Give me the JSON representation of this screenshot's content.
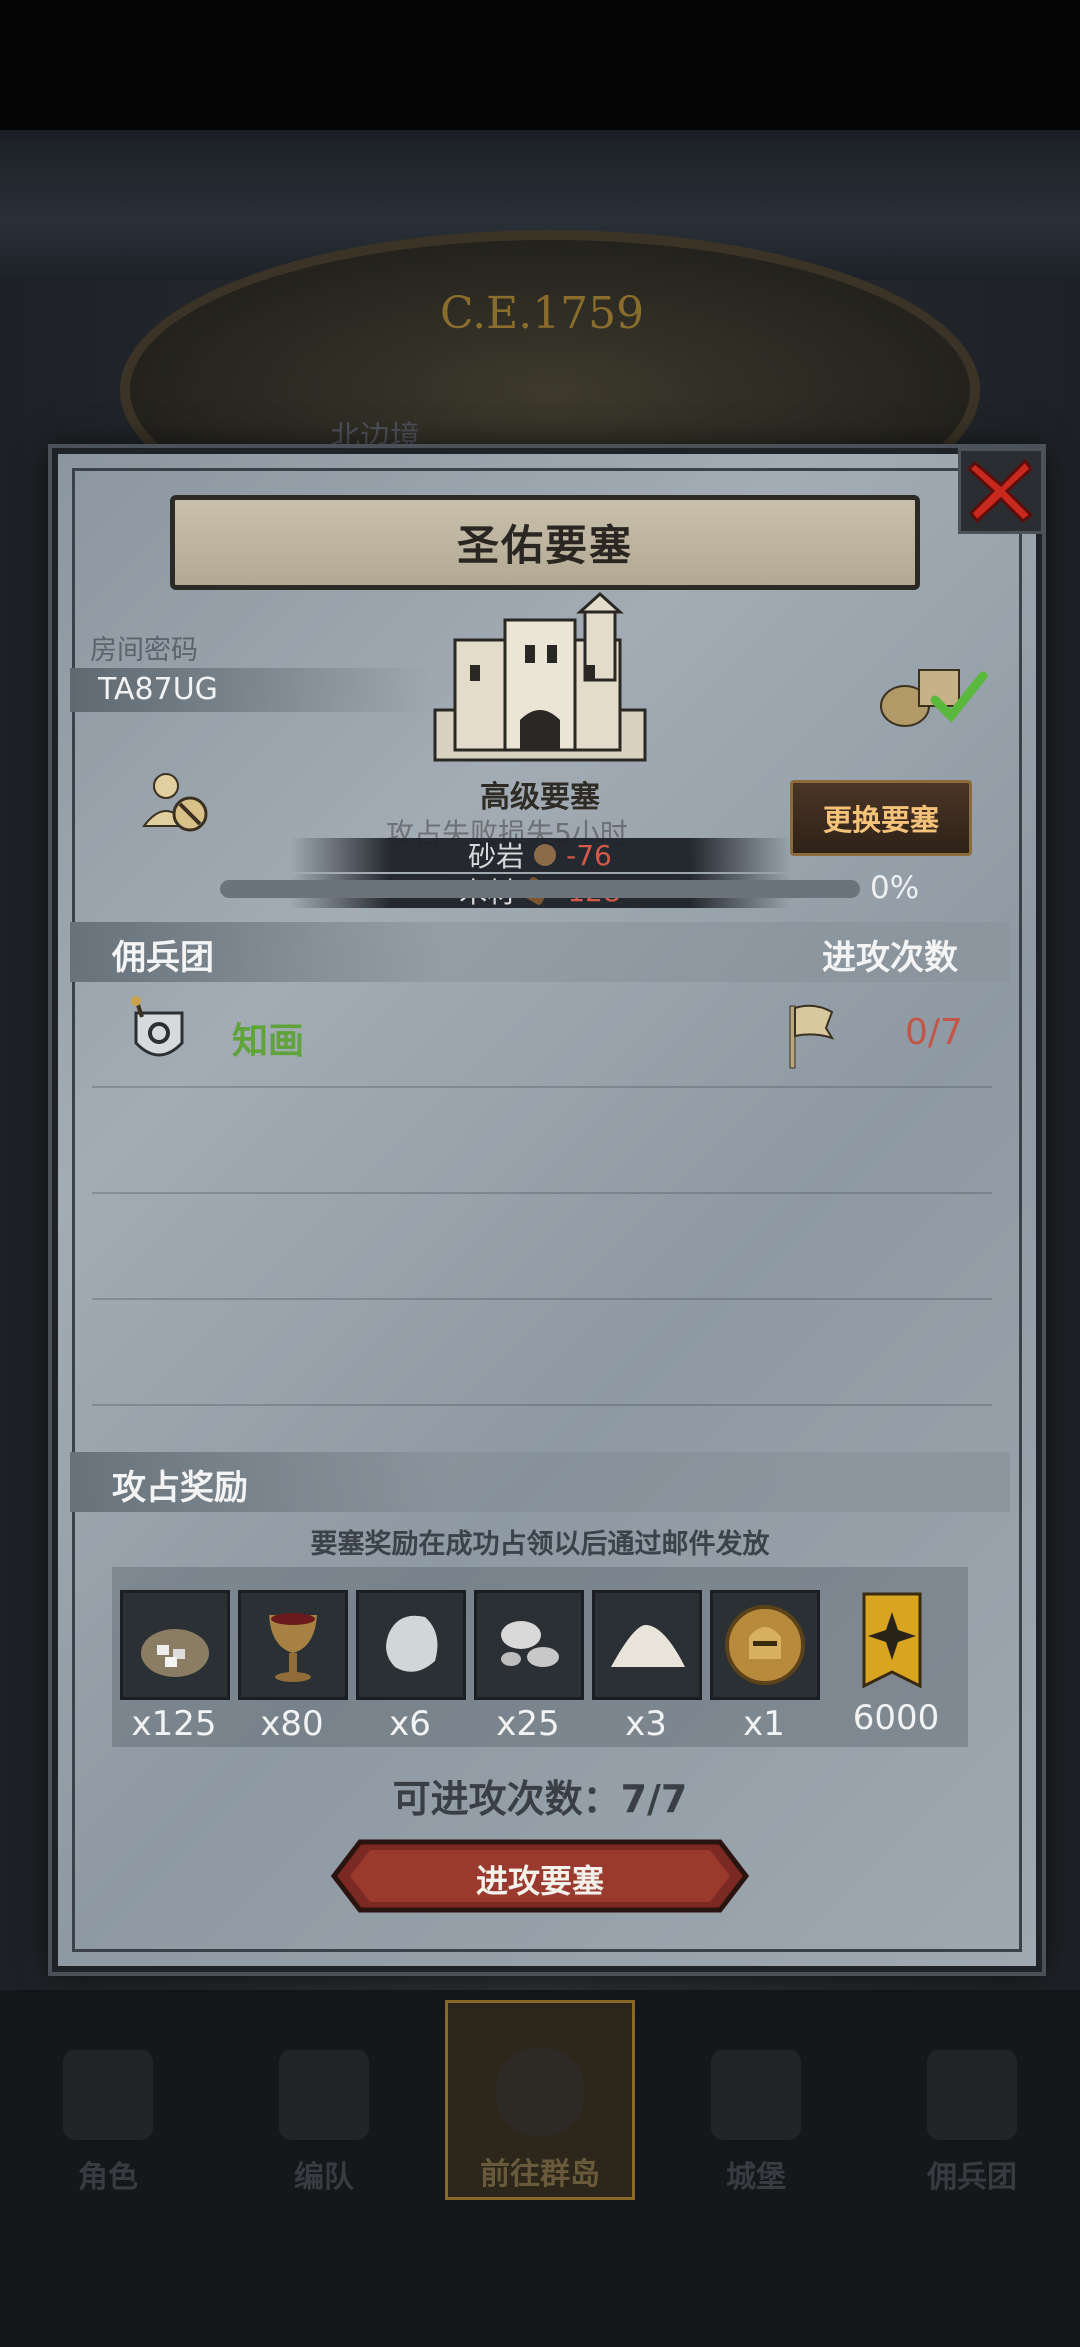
{
  "background": {
    "era_text": "C.E.1759",
    "edge_label": "北边境"
  },
  "dialog": {
    "title": "圣佑要塞",
    "room_code_label": "房间密码",
    "room_code": "TA87UG",
    "fortress_label": "高级要塞",
    "change_button": "更换要塞",
    "tooltip": {
      "ghost_text": "攻占失败损失5小时",
      "rows": [
        {
          "label": "砂岩",
          "value": "-76",
          "icon": "stone-icon"
        },
        {
          "label": "木材",
          "value": "-128",
          "icon": "wood-icon"
        }
      ]
    },
    "progress_percent": "0%",
    "progress_value": 0,
    "mercenary_header": "佣兵团",
    "attack_count_header": "进攻次数",
    "mercenary_row": {
      "name": "知画",
      "attack_count": "0/7"
    },
    "rewards_header": "攻占奖励",
    "rewards_note": "要塞奖励在成功占领以后通过邮件发放",
    "rewards": [
      {
        "icon": "stone-pile-icon",
        "count": "x125"
      },
      {
        "icon": "goblet-icon",
        "count": "x80"
      },
      {
        "icon": "white-stone-icon",
        "count": "x6"
      },
      {
        "icon": "silver-orbs-icon",
        "count": "x25"
      },
      {
        "icon": "powder-icon",
        "count": "x3"
      },
      {
        "icon": "knight-medal-icon",
        "count": "x1"
      },
      {
        "icon": "banner-icon",
        "count": "6000"
      }
    ],
    "attacks_remaining": "可进攻次数：7/7",
    "attack_button": "进攻要塞"
  },
  "bottom_nav": [
    {
      "label": "角色",
      "icon": "knight-icon",
      "active": false
    },
    {
      "label": "编队",
      "icon": "formation-icon",
      "active": false
    },
    {
      "label": "前往群岛",
      "icon": "compass-icon",
      "active": true
    },
    {
      "label": "城堡",
      "icon": "castle-icon",
      "active": false
    },
    {
      "label": "佣兵团",
      "icon": "mercenary-icon",
      "active": false
    }
  ],
  "colors": {
    "accent_gold": "#c58e3e",
    "negative_red": "#c45648",
    "mercenary_green": "#5fa33a",
    "close_red": "#c8281e"
  }
}
